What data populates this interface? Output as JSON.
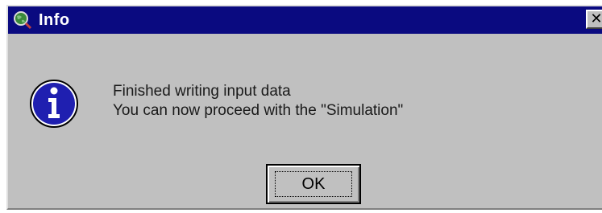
{
  "window": {
    "title": "Info",
    "title_icon": "globe-magnifier-icon",
    "close_glyph": "✕",
    "titlebar_color": "#0a0a80",
    "background_color": "#c0c0c0"
  },
  "message": {
    "icon": "info-icon",
    "icon_color": "#1f1fb0",
    "line1": "Finished writing input data",
    "line2": "You can now proceed with the \"Simulation\""
  },
  "buttons": {
    "ok_label": "OK"
  }
}
